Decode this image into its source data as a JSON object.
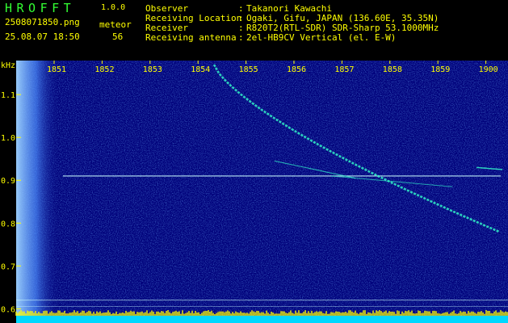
{
  "app": {
    "title": "HROFFT",
    "version": "1.0.0",
    "file_name": "2508071850.png",
    "timestamp": "25.08.07 18:50",
    "meteor_label": "meteor",
    "meteor_count": "56"
  },
  "meta": [
    {
      "label": "Observer",
      "value": "Takanori Kawachi"
    },
    {
      "label": "Receiving Location",
      "value": "Ogaki, Gifu, JAPAN (136.60E, 35.35N)"
    },
    {
      "label": "Receiver",
      "value": "R820T2(RTL-SDR) SDR-Sharp 53.1000MHz"
    },
    {
      "label": "Receiving antenna",
      "value": "2el-HB9CV Vertical (el. E-W)"
    }
  ],
  "chart_data": {
    "type": "heatmap",
    "ylabel": "kHz",
    "x_ticks": [
      "1851",
      "1852",
      "1853",
      "1854",
      "1855",
      "1856",
      "1857",
      "1858",
      "1859",
      "1900"
    ],
    "y_ticks": [
      "1.1",
      "1.0",
      "0.9",
      "0.8",
      "0.7",
      "0.6"
    ],
    "ylim": [
      0.58,
      1.17
    ],
    "grid": false,
    "colors": {
      "background": "#00007a",
      "noise_light": "#3a7cff",
      "signal": "#33ffcc",
      "carrier": "#ccffff",
      "baseline": "#ffff00"
    }
  }
}
